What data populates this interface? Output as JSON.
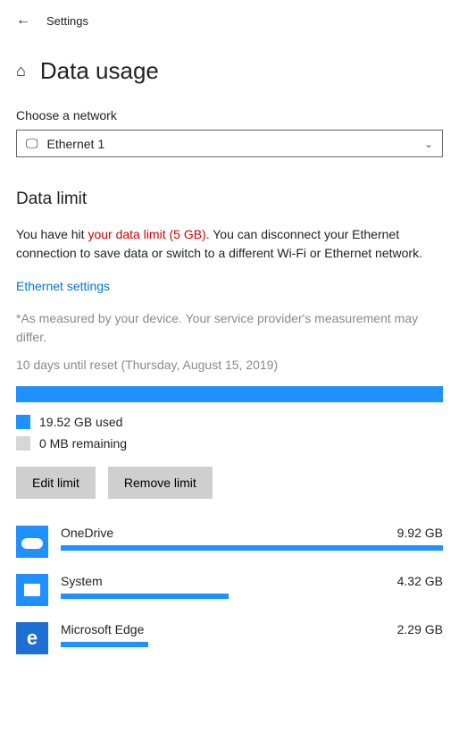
{
  "header": {
    "settings_label": "Settings",
    "page_title": "Data usage"
  },
  "network": {
    "choose_label": "Choose a network",
    "selected": "Ethernet 1"
  },
  "limit": {
    "section_title": "Data limit",
    "warn_prefix": "You have hit ",
    "warn_red": "your data limit (5 GB).",
    "warn_suffix": "  You can disconnect your Ethernet connection to save data or switch to a different Wi-Fi or Ethernet network.",
    "settings_link": "Ethernet settings",
    "measured_note": "*As measured by your device. Your service provider's measurement may differ.",
    "reset_line": "10 days until reset (Thursday, August 15, 2019)",
    "used_label": "19.52 GB used",
    "remaining_label": "0 MB remaining",
    "edit_button": "Edit limit",
    "remove_button": "Remove limit"
  },
  "apps": [
    {
      "name": "OneDrive",
      "usage": "9.92 GB",
      "bar_pct": 100
    },
    {
      "name": "System",
      "usage": "4.32 GB",
      "bar_pct": 44
    },
    {
      "name": "Microsoft Edge",
      "usage": "2.29 GB",
      "bar_pct": 23
    }
  ]
}
